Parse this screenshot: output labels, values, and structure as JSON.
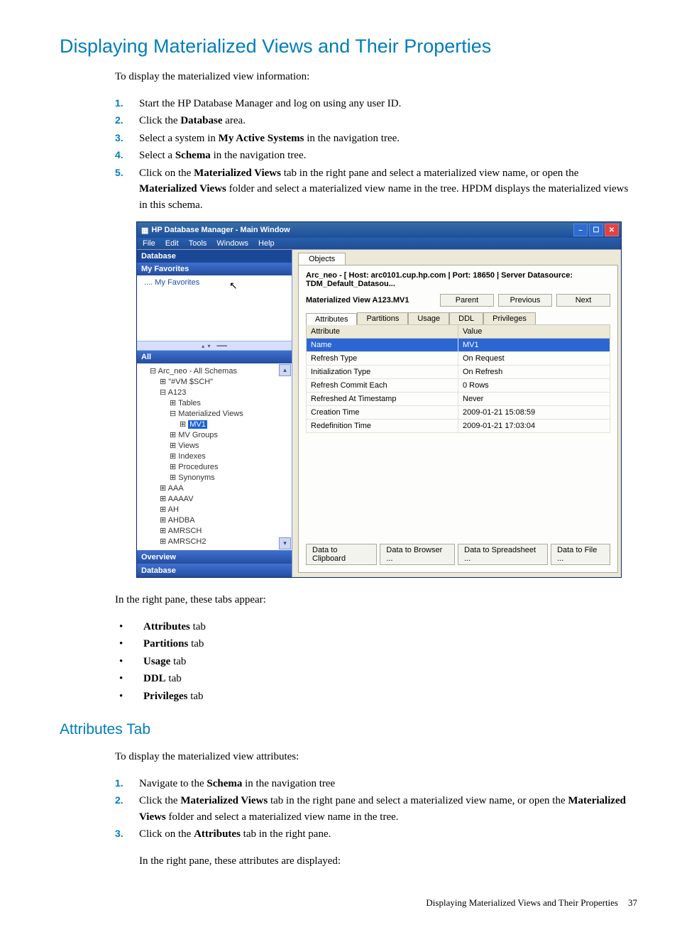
{
  "doc": {
    "title": "Displaying Materialized Views and Their Properties",
    "intro": "To display the materialized view information:",
    "steps": [
      "Start the HP Database Manager and log on using any user ID.",
      "Click the Database area.",
      "Select a system in My Active Systems in the navigation tree.",
      "Select a Schema in the navigation tree.",
      "Click on the Materialized Views tab in the right pane and select a materialized view name, or open the Materialized Views folder and select a materialized view name in the tree. HPDM displays the materialized views in this schema."
    ],
    "after_img": "In the right pane, these tabs appear:",
    "tabs_list": [
      "Attributes",
      "Partitions",
      "Usage",
      "DDL",
      "Privileges"
    ],
    "sub_title": "Attributes Tab",
    "sub_intro": "To display the materialized view attributes:",
    "sub_steps": [
      "Navigate to the Schema in the navigation tree",
      "Click the Materialized Views tab in the right pane and select a materialized view name, or open the Materialized Views folder and select a materialized view name in the tree.",
      "Click on the Attributes tab in the right pane."
    ],
    "sub_after": "In the right pane, these attributes are displayed:",
    "footer_text": "Displaying Materialized Views and Their Properties",
    "footer_num": "37"
  },
  "window": {
    "title": "HP Database Manager - Main Window",
    "menu": [
      "File",
      "Edit",
      "Tools",
      "Windows",
      "Help"
    ],
    "left": {
      "database": "Database",
      "favorites_header": "My Favorites",
      "favorites_node": "My Favorites",
      "all_header": "All",
      "tree": [
        "Arc_neo - All Schemas",
        "\"#VM $SCH\"",
        "A123",
        "Tables",
        "Materialized Views",
        "MV1",
        "MV Groups",
        "Views",
        "Indexes",
        "Procedures",
        "Synonyms",
        "AAA",
        "AAAAV",
        "AH",
        "AHDBA",
        "AMRSCH",
        "AMRSCH2"
      ],
      "overview": "Overview",
      "database_footer": "Database"
    },
    "right": {
      "objects_tab": "Objects",
      "breadcrumb": "Arc_neo - [ Host: arc0101.cup.hp.com | Port: 18650 | Server Datasource: TDM_Default_Datasou...",
      "mv_label": "Materialized View A123.MV1",
      "nav_buttons": [
        "Parent",
        "Previous",
        "Next"
      ],
      "tabs": [
        "Attributes",
        "Partitions",
        "Usage",
        "DDL",
        "Privileges"
      ],
      "col_attr": "Attribute",
      "col_val": "Value",
      "rows": [
        {
          "a": "Name",
          "v": "MV1"
        },
        {
          "a": "Refresh Type",
          "v": "On Request"
        },
        {
          "a": "Initialization Type",
          "v": "On Refresh"
        },
        {
          "a": "Refresh Commit Each",
          "v": "0 Rows"
        },
        {
          "a": "Refreshed At Timestamp",
          "v": "Never"
        },
        {
          "a": "Creation Time",
          "v": "2009-01-21 15:08:59"
        },
        {
          "a": "Redefinition Time",
          "v": "2009-01-21 17:03:04"
        }
      ],
      "export_buttons": [
        "Data to Clipboard",
        "Data to Browser ...",
        "Data to Spreadsheet ...",
        "Data to File ..."
      ]
    }
  }
}
